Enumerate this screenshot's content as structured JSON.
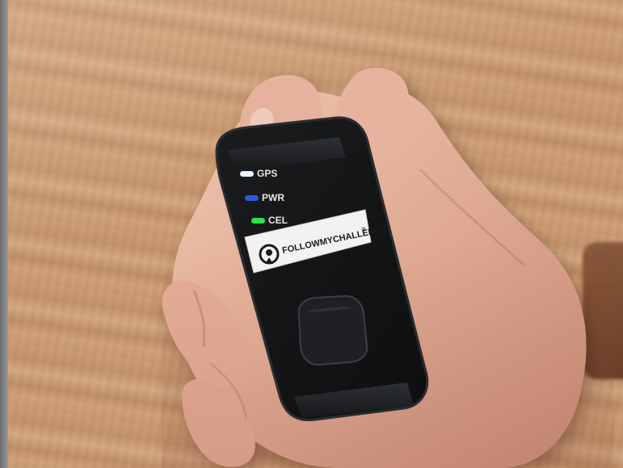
{
  "scene": {
    "description_icon": "gps-tracker-photo"
  },
  "device": {
    "leds": [
      {
        "label": "GPS",
        "color": "#e9f2ff"
      },
      {
        "label": "PWR",
        "color": "#2a5bd7"
      },
      {
        "label": "CEL",
        "color": "#2ee24f"
      }
    ],
    "brand": "FOLLOWMYCHALLENGE",
    "brand_mark": "®",
    "logo_icon": "location-pin-icon",
    "button_icon": "square-button"
  },
  "colors": {
    "device_body": "#121314",
    "device_edge": "#2a2c2f",
    "label_bg": "#f2f2f2",
    "label_fg": "#1a1a1a",
    "skin": "#e7b9a3"
  }
}
